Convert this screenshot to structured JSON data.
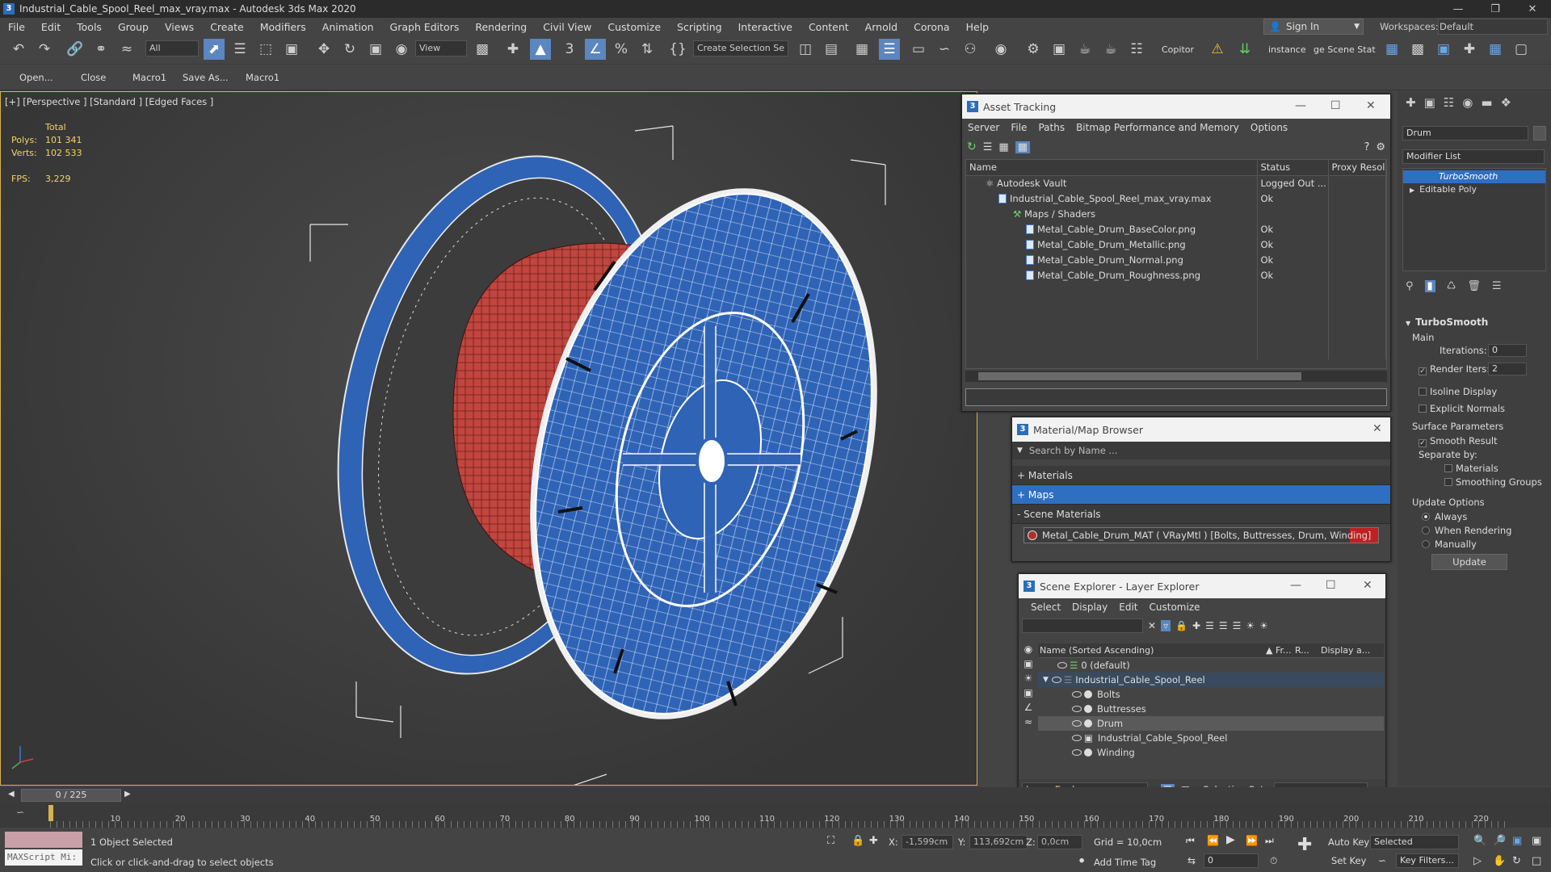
{
  "window": {
    "title": "Industrial_Cable_Spool_Reel_max_vray.max - Autodesk 3ds Max 2020",
    "app_icon": "3"
  },
  "menu": [
    "File",
    "Edit",
    "Tools",
    "Group",
    "Views",
    "Create",
    "Modifiers",
    "Animation",
    "Graph Editors",
    "Rendering",
    "Civil View",
    "Customize",
    "Scripting",
    "Interactive",
    "Content",
    "Arnold",
    "Corona",
    "Help"
  ],
  "signin": "Sign In",
  "workspaces_label": "Workspaces:",
  "workspace": "Default",
  "toolbar": {
    "filter": "All",
    "ref_coord": "View",
    "selection_set": "Create Selection Se",
    "copitor": "Copitor",
    "instance": "instance",
    "scene_state": "ge Scene Stat"
  },
  "command_bar": [
    "Open...",
    "Close",
    "Macro1",
    "Save As...",
    "Macro1"
  ],
  "viewport": {
    "label": "[+] [Perspective ] [Standard ] [Edged Faces ]",
    "stats": {
      "total_label": "Total",
      "polys_label": "Polys:",
      "polys": "101 341",
      "verts_label": "Verts:",
      "verts": "102 533",
      "fps_label": "FPS:",
      "fps": "3,229"
    }
  },
  "asset_tracking": {
    "title": "Asset Tracking",
    "menu": [
      "Server",
      "File",
      "Paths",
      "Bitmap Performance and Memory",
      "Options"
    ],
    "columns": [
      "Name",
      "Status",
      "Proxy Resol"
    ],
    "rows": [
      {
        "name": "Autodesk Vault",
        "status": "Logged Out ..."
      },
      {
        "name": "Industrial_Cable_Spool_Reel_max_vray.max",
        "status": "Ok"
      },
      {
        "name": "Maps / Shaders",
        "status": ""
      },
      {
        "name": "Metal_Cable_Drum_BaseColor.png",
        "status": "Ok"
      },
      {
        "name": "Metal_Cable_Drum_Metallic.png",
        "status": "Ok"
      },
      {
        "name": "Metal_Cable_Drum_Normal.png",
        "status": "Ok"
      },
      {
        "name": "Metal_Cable_Drum_Roughness.png",
        "status": "Ok"
      }
    ]
  },
  "material_browser": {
    "title": "Material/Map Browser",
    "search_placeholder": "Search by Name ...",
    "sections": [
      "+ Materials",
      "+ Maps",
      "- Scene Materials"
    ],
    "scene_material": "Metal_Cable_Drum_MAT  ( VRayMtl )  [Bolts, Buttresses, Drum, Winding]"
  },
  "scene_explorer": {
    "title": "Scene Explorer - Layer Explorer",
    "menu": [
      "Select",
      "Display",
      "Edit",
      "Customize"
    ],
    "columns": [
      "Name (Sorted Ascending)",
      "▲ Fr...",
      "R...",
      "Display a..."
    ],
    "rows": [
      "0 (default)",
      "Industrial_Cable_Spool_Reel",
      "Bolts",
      "Buttresses",
      "Drum",
      "Industrial_Cable_Spool_Reel",
      "Winding"
    ],
    "footer_label": "Layer Explorer",
    "selection_set_label": "Selection Set:"
  },
  "command_panel": {
    "object_name": "Drum",
    "modifier_list": "Modifier List",
    "stack": [
      "TurboSmooth",
      "Editable Poly"
    ],
    "rollout_title": "TurboSmooth",
    "main_label": "Main",
    "iterations_label": "Iterations:",
    "iterations": "0",
    "render_iters_label": "Render Iters:",
    "render_iters": "2",
    "isoline": "Isoline Display",
    "explicit_normals": "Explicit Normals",
    "surface_params": "Surface Parameters",
    "smooth_result": "Smooth Result",
    "separate_by": "Separate by:",
    "materials": "Materials",
    "smoothing_groups": "Smoothing Groups",
    "update_options": "Update Options",
    "always": "Always",
    "when_rendering": "When Rendering",
    "manually": "Manually",
    "update_btn": "Update"
  },
  "timeline": {
    "frame": "0 / 225",
    "ticks": [
      "10",
      "20",
      "30",
      "40",
      "50",
      "60",
      "70",
      "80",
      "90",
      "100",
      "110",
      "120",
      "130",
      "140",
      "150",
      "160",
      "170",
      "180",
      "190",
      "200",
      "210",
      "220"
    ]
  },
  "status": {
    "maxscript": "MAXScript Mi:",
    "selected": "1 Object Selected",
    "prompt": "Click or click-and-drag to select objects",
    "x_label": "X:",
    "x": "-1,599cm",
    "y_label": "Y:",
    "y": "113,692cm",
    "z_label": "Z:",
    "z": "0,0cm",
    "grid": "Grid = 10,0cm",
    "add_time_tag": "Add Time Tag",
    "auto_key": "Auto Key",
    "set_key": "Set Key",
    "selected_dd": "Selected",
    "key_filters": "Key Filters...",
    "frame_field": "0"
  },
  "colors": {
    "accent": "#5b86bf",
    "selection": "#2f6fc2",
    "viewport_border": "#d8b24e",
    "winding": "#c0463f",
    "reel": "#2f63b5"
  }
}
